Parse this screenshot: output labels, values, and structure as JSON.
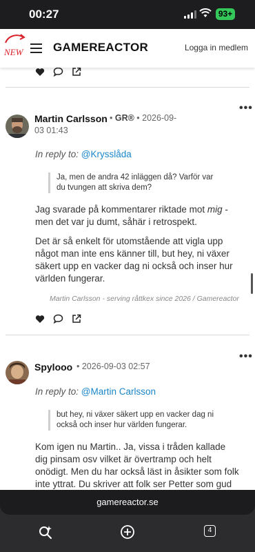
{
  "status_bar": {
    "time": "00:27",
    "battery": "93+"
  },
  "header": {
    "new_label": "NEW",
    "logo": "GAMEREACTOR",
    "login": "Logga in medlem"
  },
  "comments": [
    {
      "author": "Martin Carlsson",
      "badge": "GR®",
      "date_line1": "2026-09-",
      "date_line2": "03 01:43",
      "reply_prefix": "In reply to:",
      "reply_to": "@Krysslåda",
      "quote_line1": "Ja, men de andra 42 inläggen då? Varför var",
      "quote_line2": "du tvungen att skriva dem?",
      "p1_line1_a": "Jag svarade på kommentarer riktade mot ",
      "p1_line1_em": "mig",
      "p1_line1_b": " -",
      "p1_line2": "men det var ju dumt, såhär i retrospekt.",
      "p2_line1": "Det är så enkelt för utomstående att vigla upp",
      "p2_line2": "något man inte ens känner till, but hey, ni växer",
      "p2_line3": "säkert upp en vacker dag ni också och inser hur",
      "p2_line4": "världen fungerar.",
      "signature": "Martin Carlsson - serving råttkex since 2026 / Gamereactor"
    },
    {
      "author": "Spylooo",
      "date": "2026-09-03 02:57",
      "reply_prefix": "In reply to:",
      "reply_to": "@Martin Carlsson",
      "quote_line1": "but hey, ni växer säkert upp en vacker dag ni",
      "quote_line2": "också och inser hur världen fungerar.",
      "p1_line1": "Kom igen nu Martin.. Ja, vissa i tråden kallade",
      "p1_line2": "dig pinsam osv vilket är övertramp och helt",
      "p1_line3": "onödigt. Men du har också läst in åsikter som folk",
      "p1_line4": "inte yttrat. Du skriver att folk ser Petter som gud"
    }
  ],
  "browser": {
    "url": "gamereactor.se",
    "tab_count": "4"
  },
  "colors": {
    "link": "#1a86c9",
    "new_badge": "#d9232d",
    "battery": "#34c759"
  }
}
